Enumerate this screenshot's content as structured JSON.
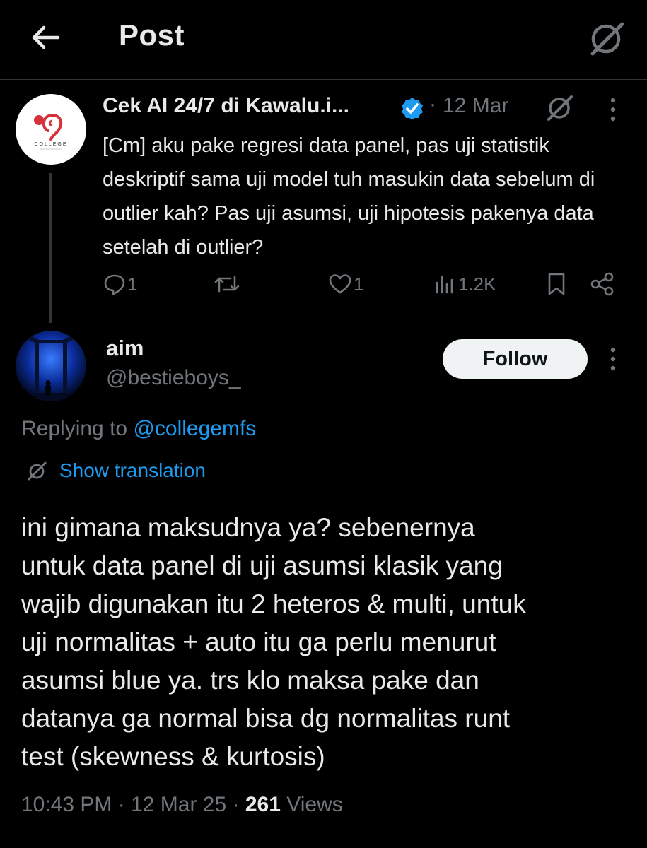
{
  "header": {
    "title": "Post",
    "back_icon": "arrow-left-icon",
    "grok_icon": "grok-icon"
  },
  "parent_post": {
    "author_name": "Cek AI 24/7 di Kawalu.i...",
    "verified": true,
    "separator": "·",
    "date": "12 Mar",
    "text": "[Cm] aku pake regresi data panel, pas uji statistik deskriptif sama uji model tuh masukin data sebelum di outlier kah? Pas uji asumsi, uji hipotesis pakenya data setelah di outlier?",
    "avatar_logo_text": "COLLEGE",
    "actions": {
      "replies": "1",
      "reposts": "",
      "likes": "1",
      "views": "1.2K"
    }
  },
  "reply_post": {
    "author_name": "aim",
    "handle": "@bestieboys_",
    "follow_label": "Follow",
    "replying_prefix": "Replying to ",
    "replying_to": "@collegemfs",
    "translate_label": "Show translation",
    "text": "ini gimana maksudnya ya? sebenernya\nuntuk data panel di uji asumsi klasik yang\nwajib digunakan itu 2 heteros & multi, untuk\nuji normalitas + auto itu ga perlu menurut\nasumsi blue ya. trs klo maksa pake dan\ndatanya ga normal bisa dg normalitas runt\ntest (skewness & kurtosis)",
    "time": "10:43 PM",
    "dot1": " · ",
    "date": "12 Mar 25",
    "dot2": " · ",
    "views_count": "261",
    "views_label": " Views"
  },
  "colors": {
    "background": "#000000",
    "text": "#e7e9ea",
    "muted": "#71767b",
    "accent": "#1d9bf0",
    "verified": "#1d9bf0",
    "logo_red": "#d6323a"
  }
}
